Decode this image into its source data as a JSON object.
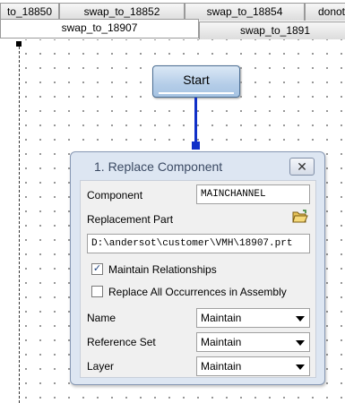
{
  "tabs_row1": [
    {
      "label": "to_18850"
    },
    {
      "label": "swap_to_18852"
    },
    {
      "label": "swap_to_18854"
    },
    {
      "label": "donot"
    }
  ],
  "tabs_row2": [
    {
      "label": "swap_to_18907",
      "active": true
    },
    {
      "label": "swap_to_1891",
      "active": false
    }
  ],
  "canvas": {
    "start_node": {
      "label": "Start"
    }
  },
  "panel": {
    "title": "1. Replace Component",
    "close_icon": "close-icon",
    "component": {
      "label": "Component",
      "value": "MAINCHANNEL"
    },
    "replacement_part": {
      "label": "Replacement Part",
      "icon": "folder-open-icon",
      "path": "D:\\andersot\\customer\\VMH\\18907.prt"
    },
    "maintain_relationships": {
      "label": "Maintain Relationships",
      "checked": true
    },
    "replace_all": {
      "label": "Replace All Occurrences in Assembly",
      "checked": false
    },
    "name": {
      "label": "Name",
      "value": "Maintain"
    },
    "reference_set": {
      "label": "Reference Set",
      "value": "Maintain"
    },
    "layer": {
      "label": "Layer",
      "value": "Maintain"
    }
  },
  "colors": {
    "connector": "#1030c8",
    "panel_bg": "#dde6f2",
    "start_node": "#b4cde8"
  }
}
